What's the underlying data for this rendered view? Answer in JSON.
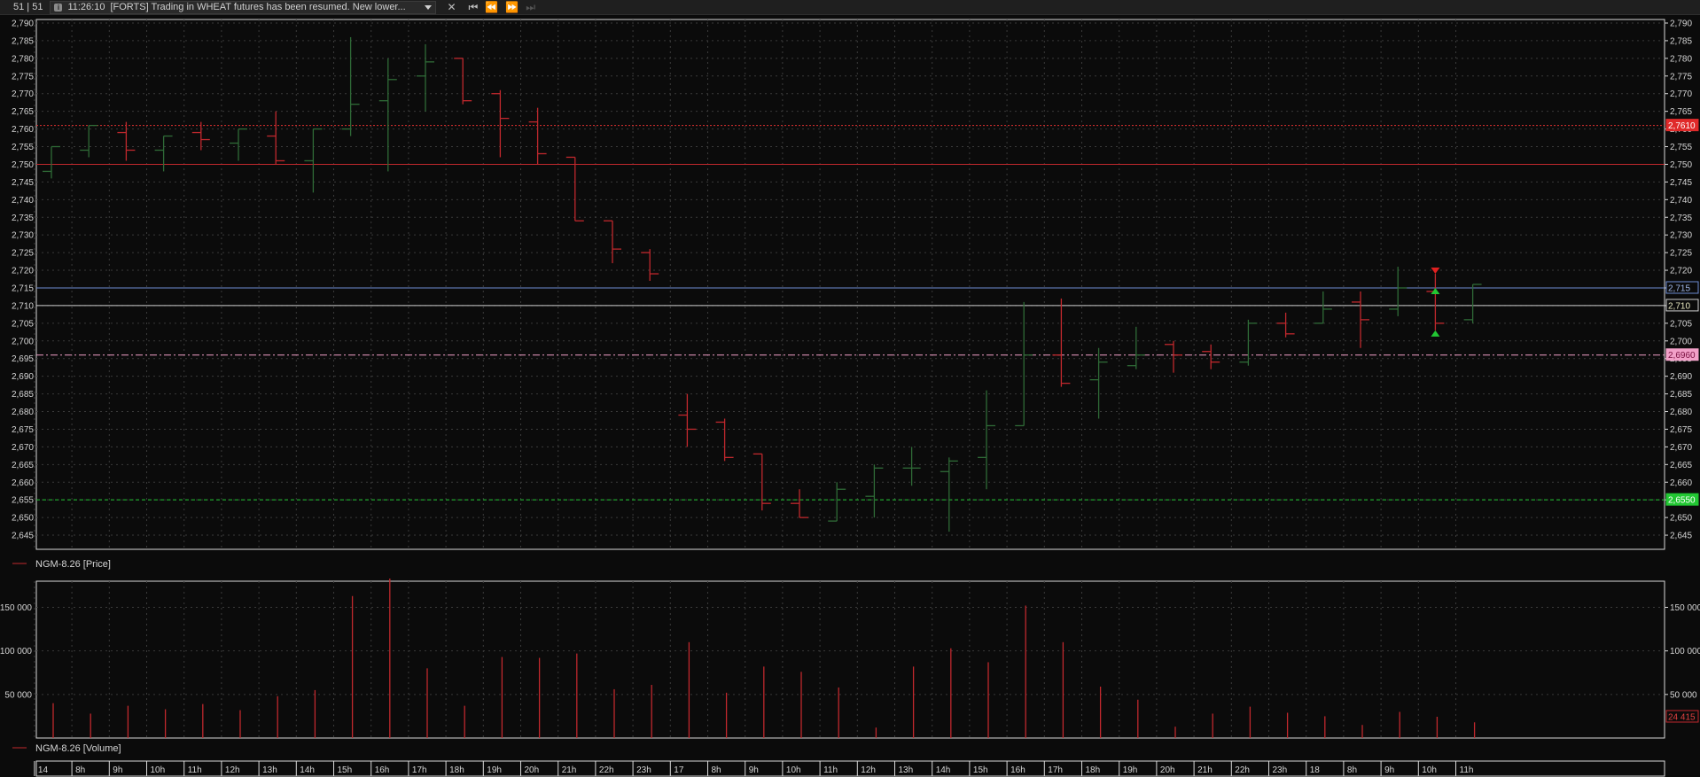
{
  "topbar": {
    "counter": "51 | 51",
    "news_time": "11:26:10",
    "news_text": "[FORTS] Trading in WHEAT futures has been resumed. New lower...",
    "close_icon": "close-icon",
    "nav_icons": [
      "first-icon",
      "prev-icon",
      "next-icon",
      "last-icon"
    ]
  },
  "colors": {
    "up_bar": "#2f6b37",
    "down_bar": "#c0282d",
    "volume_bar": "#c0282d",
    "grid": "#3b3b3b",
    "frame": "#d8d8d8"
  },
  "price_panel": {
    "legend": "NGM-8.26 [Price]",
    "y_ticks": [
      "2,790",
      "2,785",
      "2,780",
      "2,775",
      "2,770",
      "2,765",
      "2,760",
      "2,755",
      "2,750",
      "2,745",
      "2,740",
      "2,735",
      "2,730",
      "2,725",
      "2,720",
      "2,715",
      "2,710",
      "2,705",
      "2,700",
      "2,695",
      "2,690",
      "2,685",
      "2,680",
      "2,675",
      "2,670",
      "2,665",
      "2,660",
      "2,655",
      "2,650",
      "2,645"
    ],
    "right_labels": [
      {
        "text": "2,7610",
        "value": 2761,
        "bg": "#e02a2a",
        "fg": "#ffffff"
      },
      {
        "text": "2,715",
        "value": 2715,
        "bg": "#0b0b0b",
        "fg": "#9fb7e8",
        "border": "#6d8bd0"
      },
      {
        "text": "2,710",
        "value": 2710,
        "bg": "#0b0b0b",
        "fg": "#e8e8c0",
        "border": "#cfcfcf"
      },
      {
        "text": "2,6960",
        "value": 2696,
        "bg": "#f2a0c8",
        "fg": "#7a1040"
      },
      {
        "text": "2,6550",
        "value": 2655,
        "bg": "#22c733",
        "fg": "#ffffff"
      }
    ]
  },
  "volume_panel": {
    "legend": "NGM-8.26 [Volume]",
    "y_ticks_left": [
      "150 000",
      "100 000",
      "50 000"
    ],
    "y_ticks_right": [
      "150 000",
      "100 000",
      "50 000"
    ],
    "last_label": "24 415"
  },
  "time_axis": {
    "labels": [
      "14",
      "8h",
      "9h",
      "10h",
      "11h",
      "12h",
      "13h",
      "14h",
      "15h",
      "16h",
      "17h",
      "18h",
      "19h",
      "20h",
      "21h",
      "22h",
      "23h",
      "17",
      "8h",
      "9h",
      "10h",
      "11h",
      "12h",
      "13h",
      "14h",
      "15h",
      "16h",
      "17h",
      "18h",
      "19h",
      "20h",
      "21h",
      "22h",
      "23h",
      "18",
      "8h",
      "9h",
      "10h",
      "11h"
    ]
  },
  "chart_data": {
    "type": "ohlc",
    "instrument": "NGM-8.26",
    "ylim": [
      2641,
      2791
    ],
    "levels": [
      {
        "value": 2761,
        "style": "dotted",
        "color": "#e03030"
      },
      {
        "value": 2750,
        "style": "solid",
        "color": "#c0282d"
      },
      {
        "value": 2715,
        "style": "solid",
        "color": "#6d8bd0"
      },
      {
        "value": 2710,
        "style": "solid",
        "color": "#cfcfcf"
      },
      {
        "value": 2696,
        "style": "dashdot",
        "color": "#f2a0c8"
      },
      {
        "value": 2655,
        "style": "dashed",
        "color": "#22c733"
      }
    ],
    "bars": [
      {
        "o": 2748,
        "h": 2755,
        "l": 2746,
        "c": 2755
      },
      {
        "o": 2754,
        "h": 2761,
        "l": 2752,
        "c": 2761
      },
      {
        "o": 2759,
        "h": 2762,
        "l": 2751,
        "c": 2754
      },
      {
        "o": 2754,
        "h": 2758,
        "l": 2748,
        "c": 2758
      },
      {
        "o": 2759,
        "h": 2762,
        "l": 2754,
        "c": 2757
      },
      {
        "o": 2756,
        "h": 2760,
        "l": 2751,
        "c": 2760
      },
      {
        "o": 2758,
        "h": 2765,
        "l": 2750,
        "c": 2751
      },
      {
        "o": 2751,
        "h": 2760,
        "l": 2742,
        "c": 2760
      },
      {
        "o": 2760,
        "h": 2786,
        "l": 2758,
        "c": 2767
      },
      {
        "o": 2768,
        "h": 2780,
        "l": 2748,
        "c": 2774
      },
      {
        "o": 2775,
        "h": 2784,
        "l": 2765,
        "c": 2779
      },
      {
        "o": 2780,
        "h": 2780,
        "l": 2767,
        "c": 2768
      },
      {
        "o": 2770,
        "h": 2771,
        "l": 2752,
        "c": 2763
      },
      {
        "o": 2762,
        "h": 2766,
        "l": 2750,
        "c": 2753
      },
      {
        "o": 2752,
        "h": 2752,
        "l": 2734,
        "c": 2734
      },
      {
        "o": 2734,
        "h": 2734,
        "l": 2722,
        "c": 2726
      },
      {
        "o": 2725,
        "h": 2726,
        "l": 2717,
        "c": 2719
      },
      {
        "o": 2679,
        "h": 2685,
        "l": 2670,
        "c": 2675
      },
      {
        "o": 2677,
        "h": 2678,
        "l": 2666,
        "c": 2667
      },
      {
        "o": 2668,
        "h": 2668,
        "l": 2652,
        "c": 2654
      },
      {
        "o": 2654,
        "h": 2658,
        "l": 2650,
        "c": 2650
      },
      {
        "o": 2649,
        "h": 2660,
        "l": 2649,
        "c": 2658
      },
      {
        "o": 2656,
        "h": 2665,
        "l": 2650,
        "c": 2664
      },
      {
        "o": 2664,
        "h": 2670,
        "l": 2659,
        "c": 2664
      },
      {
        "o": 2663,
        "h": 2667,
        "l": 2646,
        "c": 2666
      },
      {
        "o": 2667,
        "h": 2686,
        "l": 2658,
        "c": 2676
      },
      {
        "o": 2676,
        "h": 2711,
        "l": 2676,
        "c": 2696
      },
      {
        "o": 2696,
        "h": 2712,
        "l": 2687,
        "c": 2688
      },
      {
        "o": 2689,
        "h": 2698,
        "l": 2678,
        "c": 2694
      },
      {
        "o": 2693,
        "h": 2704,
        "l": 2692,
        "c": 2696
      },
      {
        "o": 2699,
        "h": 2700,
        "l": 2691,
        "c": 2696
      },
      {
        "o": 2697,
        "h": 2699,
        "l": 2692,
        "c": 2694
      },
      {
        "o": 2694,
        "h": 2706,
        "l": 2693,
        "c": 2705
      },
      {
        "o": 2705,
        "h": 2708,
        "l": 2701,
        "c": 2702
      },
      {
        "o": 2705,
        "h": 2714,
        "l": 2705,
        "c": 2709
      },
      {
        "o": 2711,
        "h": 2714,
        "l": 2698,
        "c": 2706
      },
      {
        "o": 2709,
        "h": 2721,
        "l": 2707,
        "c": 2715
      },
      {
        "o": 2714,
        "h": 2719,
        "l": 2703,
        "c": 2705
      },
      {
        "o": 2706,
        "h": 2716,
        "l": 2705,
        "c": 2716
      }
    ],
    "volume": [
      40000,
      28000,
      37000,
      33000,
      39000,
      32000,
      48000,
      55000,
      163000,
      183000,
      80000,
      37000,
      93000,
      92000,
      97000,
      56000,
      61000,
      110000,
      52000,
      82000,
      76000,
      58000,
      12000,
      82000,
      103000,
      87000,
      152000,
      110000,
      59000,
      44000,
      13000,
      28000,
      36000,
      29000,
      25000,
      15000,
      30000,
      24415,
      18000
    ],
    "volume_ylim": [
      0,
      180000
    ],
    "markers": [
      {
        "bar": 37,
        "value": 2720,
        "type": "sell-triangle",
        "color": "#e02020"
      },
      {
        "bar": 37,
        "value": 2714,
        "type": "buy-triangle",
        "color": "#22c733"
      },
      {
        "bar": 37,
        "value": 2702,
        "type": "buy-triangle",
        "color": "#22c733"
      }
    ]
  }
}
